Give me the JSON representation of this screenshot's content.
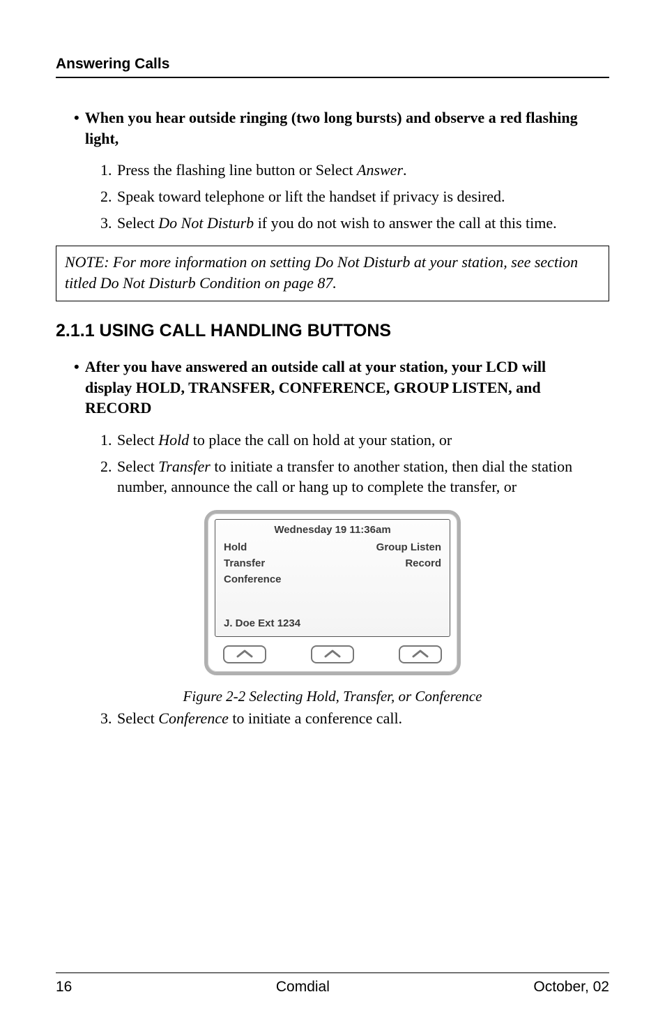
{
  "header": {
    "running_head": "Answering Calls"
  },
  "sectionA": {
    "lead": "When you hear outside ringing (two long bursts) and observe a red flashing light,",
    "bullet": "•",
    "steps": [
      {
        "pre": "Press the  flashing line button or Select ",
        "ital": "Answer",
        "post": "."
      },
      {
        "pre": "Speak toward telephone or lift the handset if privacy is desired."
      },
      {
        "pre": "Select ",
        "ital": "Do Not Disturb",
        "post": " if you do not wish to answer the call at this time."
      }
    ]
  },
  "note": {
    "text": "NOTE:  For more information on setting  Do Not Disturb at your station, see section titled Do Not Disturb Condition on page 87."
  },
  "subheading": "2.1.1  USING CALL HANDLING BUTTONS",
  "sectionB": {
    "bullet": "•",
    "lead": "After you have answered an outside call at your station, your LCD will display HOLD, TRANSFER,  CONFERENCE, GROUP LISTEN, and RECORD",
    "steps": [
      {
        "pre": "Select ",
        "ital": "Hold",
        "post": " to place the call on hold at your station, or"
      },
      {
        "pre": "Select ",
        "ital": "Transfer",
        "post": " to initiate a transfer to another station, then dial the station number, announce the call or hang up to complete the transfer, or"
      }
    ]
  },
  "lcd": {
    "datetime": "Wednesday 19  11:36am",
    "left1": "Hold",
    "right1": "Group Listen",
    "left2": "Transfer",
    "right2": "Record",
    "left3": "Conference",
    "extension": "J. Doe Ext 1234"
  },
  "figure_caption": "Figure 2-2  Selecting Hold, Transfer, or Conference",
  "step3": {
    "pre": "Select ",
    "ital": "Conference",
    "post": " to initiate a conference call."
  },
  "footer": {
    "page": "16",
    "center": "Comdial",
    "right": "October, 02"
  }
}
